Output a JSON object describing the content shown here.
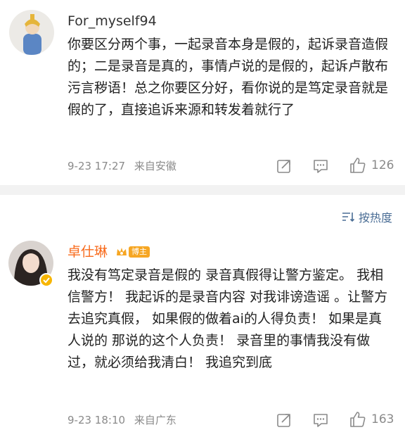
{
  "comments": [
    {
      "username": "For_myself94",
      "text": "你要区分两个事，一起录音本身是假的，起诉录音造假的；二是录音是真的，事情卢说的是假的，起诉卢散布污言秽语！总之你要区分好，看你说的是笃定录音就是假的了，直接追诉来源和转发着就行了",
      "time": "9-23 17:27",
      "location": "来自安徽",
      "likes": "126"
    },
    {
      "username": "卓仕琳",
      "badge": "博主",
      "text": "我没有笃定录音是假的 录音真假得让警方鉴定。 我相信警方！ 我起诉的是录音内容 对我诽谤造谣 。让警方去追究真假， 如果假的做着ai的人得负责！ 如果是真人说的 那说的这个人负责！ 录音里的事情我没有做过，就必须给我清白！ 我追究到底",
      "time": "9-23 18:10",
      "location": "来自广东",
      "likes": "163"
    }
  ],
  "sort": {
    "label": "按热度"
  },
  "colors": {
    "username_default": "#333333",
    "username_vip": "#f86b1d",
    "link_blue": "#4a6d95",
    "meta_gray": "#8a8a8a",
    "divider": "#f2f2f2"
  },
  "icons": [
    "share-icon",
    "comment-icon",
    "like-icon",
    "sort-icon",
    "crown-icon",
    "verified-icon"
  ]
}
